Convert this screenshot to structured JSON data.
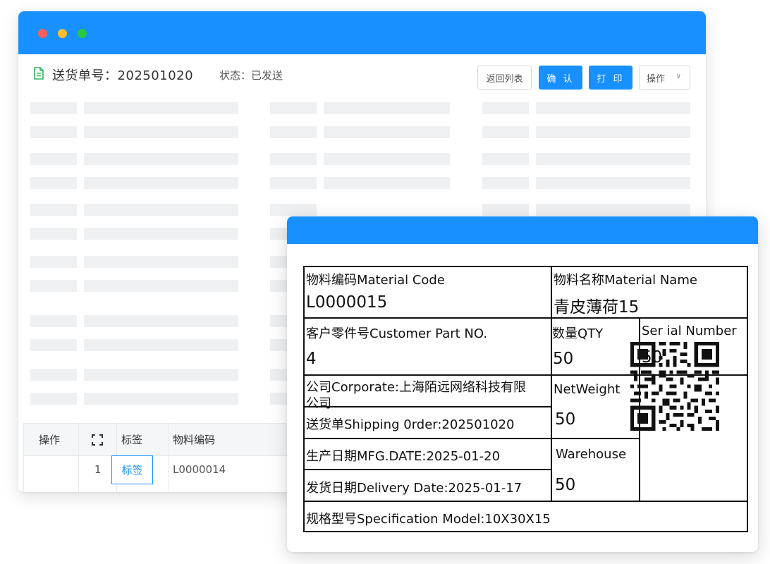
{
  "back_window": {
    "doc_title": "送货单号：202501020",
    "status": "状态：已发送",
    "buttons": {
      "back": "返回列表",
      "confirm": "确 认",
      "print": "打 印",
      "ops": "操作"
    },
    "table": {
      "headers": {
        "ops": "操作",
        "tag": "标签",
        "code": "物料编码"
      },
      "rows": [
        {
          "index": "1",
          "tag_button": "标签",
          "code": "L0000014"
        }
      ]
    }
  },
  "label": {
    "material_code_label": "物料编码Material Code",
    "material_code_value": "L0000015",
    "material_name_label": "物料名称Material Name",
    "material_name_value": "青皮薄荷15",
    "customer_part_label": "客户零件号Customer Part NO.",
    "customer_part_value": "4",
    "qty_label": "数量QTY",
    "qty_value": "50",
    "serial_label": "Ser ial Number",
    "serial_value": "50",
    "corporate_line1": "公司Corporate:上海陌远网络科技有限",
    "corporate_line2": "公司",
    "netweight_label": "NetWeight",
    "netweight_value": "50",
    "shipping_order": "送货单Shipping 0rder:202501020",
    "mfg_date": "生产日期MFG.DATE:2025-01-20",
    "warehouse_label": "Warehouse",
    "warehouse_value": "50",
    "delivery_date": "发货日期Delivery Date:2025-01-17",
    "spec_model": "规格型号Specification Model:10X30X15"
  },
  "colors": {
    "accent": "#1890ff",
    "skeleton": "#eef0f2",
    "dot_red": "#ff5f57",
    "dot_yellow": "#febc2e",
    "dot_green": "#28c840"
  },
  "icons": [
    "document-icon",
    "fullscreen-icon",
    "chevron-down-icon",
    "qr-code-icon"
  ]
}
